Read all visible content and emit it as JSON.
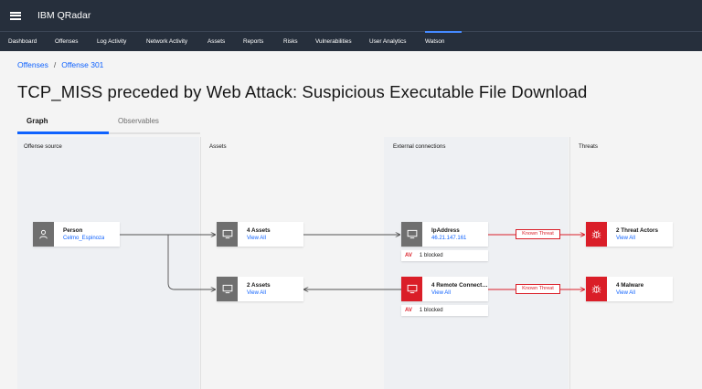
{
  "app": {
    "brand": "IBM QRadar"
  },
  "nav": {
    "items": [
      "Dashboard",
      "Offenses",
      "Log Activity",
      "Network Activity",
      "Assets",
      "Reports",
      "Risks",
      "Vulnerabilities",
      "User Analytics",
      "Watson"
    ],
    "active": "Watson"
  },
  "breadcrumb": {
    "root": "Offenses",
    "separator": "/",
    "current": "Offense 301"
  },
  "page": {
    "title": "TCP_MISS preceded by Web Attack: Suspicious Executable File Download"
  },
  "tabs": [
    {
      "label": "Graph",
      "active": true
    },
    {
      "label": "Observables",
      "active": false
    }
  ],
  "columns": {
    "offense_source": "Offense source",
    "assets": "Assets",
    "external": "External connections",
    "threats": "Threats"
  },
  "nodes": {
    "person": {
      "title": "Person",
      "sub": "Celmo_Espinoza",
      "icon": "user-icon"
    },
    "assets4": {
      "title": "4 Assets",
      "sub": "View All",
      "icon": "monitor-icon"
    },
    "assets2": {
      "title": "2 Assets",
      "sub": "View All",
      "icon": "monitor-icon"
    },
    "ip": {
      "title": "IpAddress",
      "sub": "46.21.147.161",
      "icon": "monitor-icon",
      "blocked_av": "AV",
      "blocked_text": "1 blocked"
    },
    "remote": {
      "title": "4 Remote Connect…",
      "sub": "View All",
      "icon": "monitor-icon",
      "blocked_av": "AV",
      "blocked_text": "1 blocked"
    },
    "actors": {
      "title": "2 Threat Actors",
      "sub": "View All",
      "icon": "bug-icon"
    },
    "malware": {
      "title": "4 Malware",
      "sub": "View All",
      "icon": "bug-icon"
    }
  },
  "edge_labels": {
    "known_threat_1": "Known Threat",
    "known_threat_2": "Known Threat"
  },
  "colors": {
    "topbar": "#262f3c",
    "accent": "#0f62fe",
    "danger": "#da1e28",
    "neutral_icon": "#6f6f6f"
  }
}
